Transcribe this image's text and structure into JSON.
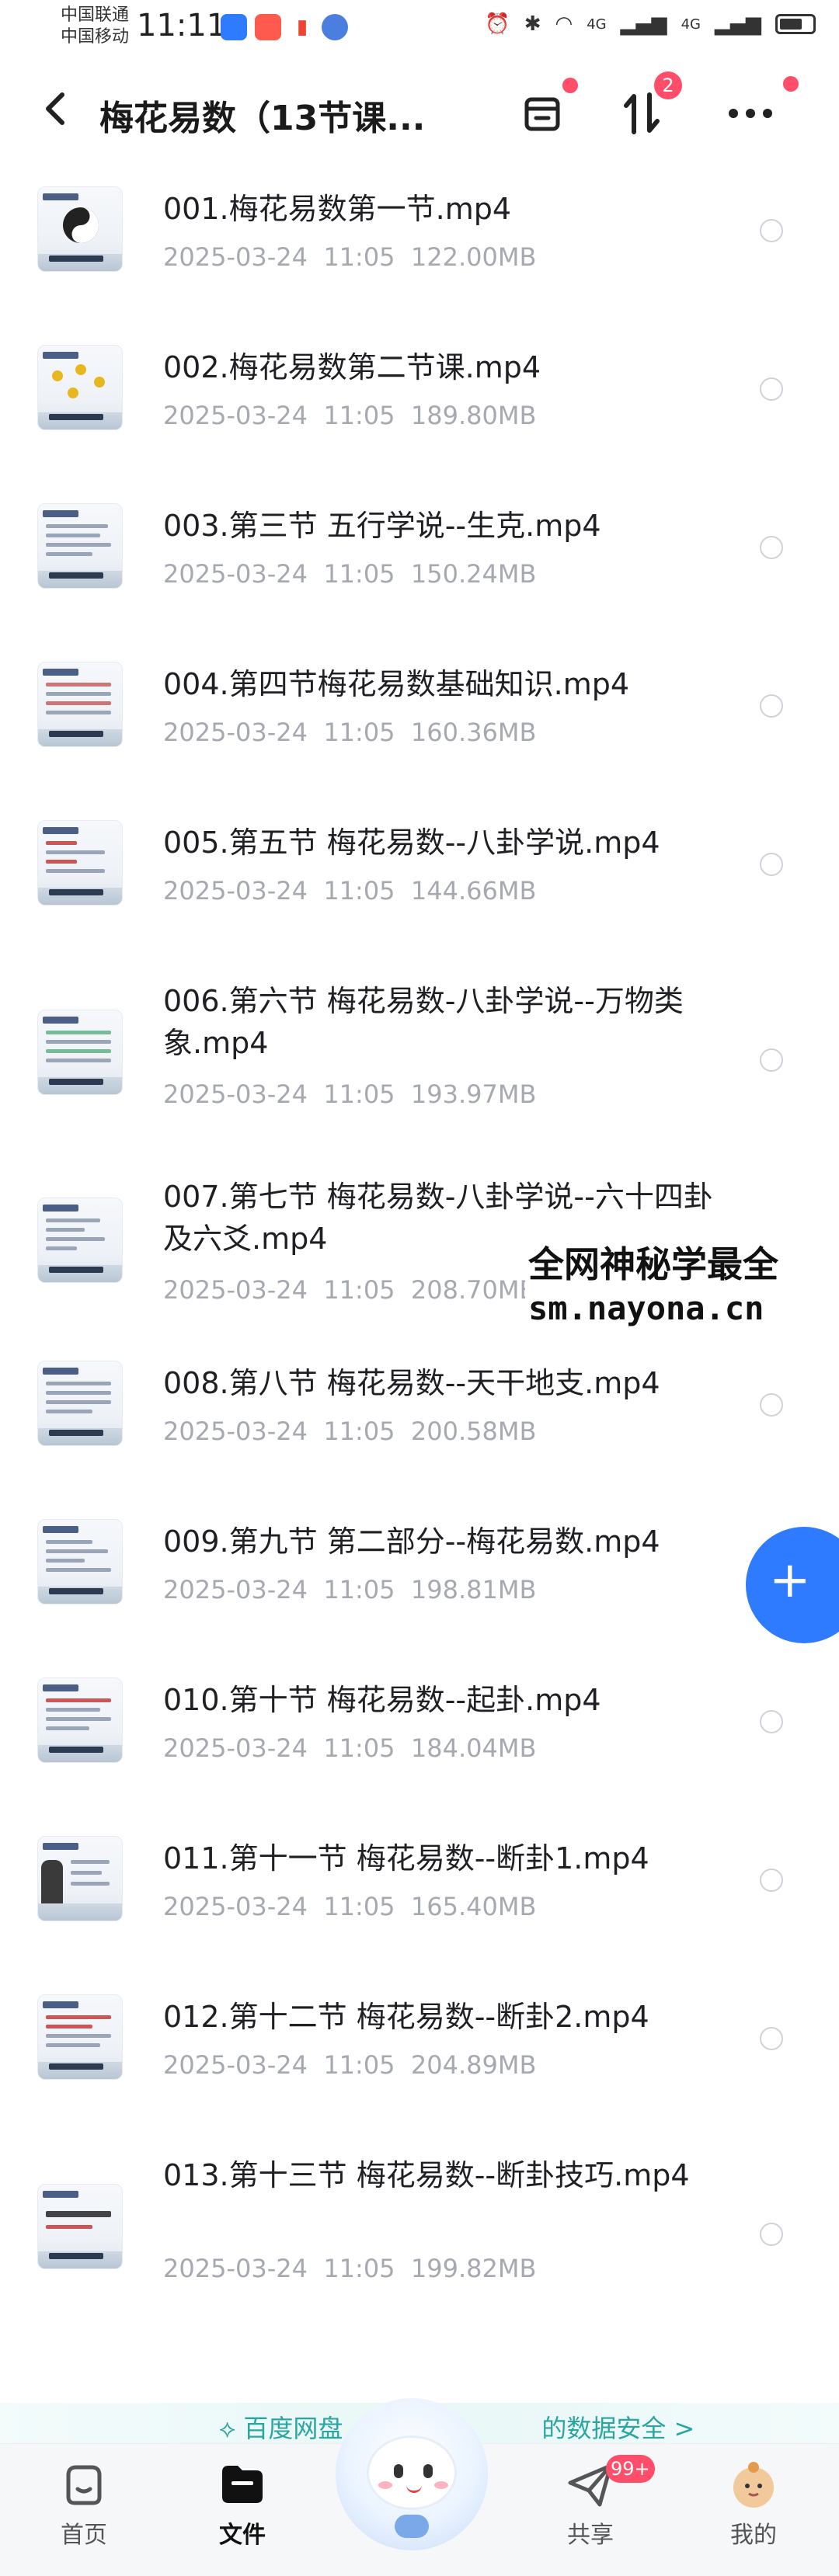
{
  "status_bar": {
    "carrier_1": "中国联通",
    "carrier_2": "中国移动",
    "time": "11:11",
    "signal_1": "4G",
    "signal_2": "4G"
  },
  "header": {
    "back_icon": "chevron-left-icon",
    "title": "梅花易数（13节课...",
    "actions": [
      {
        "icon": "archive-box-icon",
        "badge": ""
      },
      {
        "icon": "sort-arrows-icon",
        "badge": "2"
      },
      {
        "icon": "more-dots-icon",
        "badge": ""
      }
    ]
  },
  "files": [
    {
      "name": "001.梅花易数第一节.mp4",
      "date": "2025-03-24",
      "time": "11:05",
      "size": "122.00MB"
    },
    {
      "name": "002.梅花易数第二节课.mp4",
      "date": "2025-03-24",
      "time": "11:05",
      "size": "189.80MB"
    },
    {
      "name": "003.第三节 五行学说--生克.mp4",
      "date": "2025-03-24",
      "time": "11:05",
      "size": "150.24MB"
    },
    {
      "name": "004.第四节梅花易数基础知识.mp4",
      "date": "2025-03-24",
      "time": "11:05",
      "size": "160.36MB"
    },
    {
      "name": "005.第五节 梅花易数--八卦学说.mp4",
      "date": "2025-03-24",
      "time": "11:05",
      "size": "144.66MB"
    },
    {
      "name": "006.第六节 梅花易数-八卦学说--万物类象.mp4",
      "date": "2025-03-24",
      "time": "11:05",
      "size": "193.97MB"
    },
    {
      "name": "007.第七节 梅花易数-八卦学说--六十四卦及六爻.mp4",
      "date": "2025-03-24",
      "time": "11:05",
      "size": "208.70MB"
    },
    {
      "name": "008.第八节 梅花易数--天干地支.mp4",
      "date": "2025-03-24",
      "time": "11:05",
      "size": "200.58MB"
    },
    {
      "name": "009.第九节 第二部分--梅花易数.mp4",
      "date": "2025-03-24",
      "time": "11:05",
      "size": "198.81MB"
    },
    {
      "name": "010.第十节 梅花易数--起卦.mp4",
      "date": "2025-03-24",
      "time": "11:05",
      "size": "184.04MB"
    },
    {
      "name": "011.第十一节 梅花易数--断卦1.mp4",
      "date": "2025-03-24",
      "time": "11:05",
      "size": "165.40MB"
    },
    {
      "name": "012.第十二节 梅花易数--断卦2.mp4",
      "date": "2025-03-24",
      "time": "11:05",
      "size": "204.89MB"
    },
    {
      "name": "013.第十三节 梅花易数--断卦技巧.mp4",
      "date": "2025-03-24",
      "time": "11:05",
      "size": "199.82MB"
    }
  ],
  "watermark": {
    "line1": "全网神秘学最全",
    "line2": "sm.nayona.cn"
  },
  "fab": {
    "icon": "plus-icon",
    "label": "+"
  },
  "banner": {
    "icon": "baidu-netdisk-icon",
    "text_start": "百度网盘",
    "text_end": "的数据安全 >"
  },
  "bottom_nav": {
    "items": [
      {
        "icon": "home-icon",
        "label": "首页",
        "active": false,
        "badge": ""
      },
      {
        "icon": "folder-icon",
        "label": "文件",
        "active": true,
        "badge": ""
      },
      {
        "icon": "share-paper-plane-icon",
        "label": "共享",
        "active": false,
        "badge": "99+"
      },
      {
        "icon": "profile-avatar-icon",
        "label": "我的",
        "active": false,
        "badge": ""
      }
    ]
  },
  "colors": {
    "accent": "#2f7bff",
    "badge": "#ff4d6a",
    "meta_text": "#a6a9b0",
    "banner_text": "#2aa5a0"
  }
}
